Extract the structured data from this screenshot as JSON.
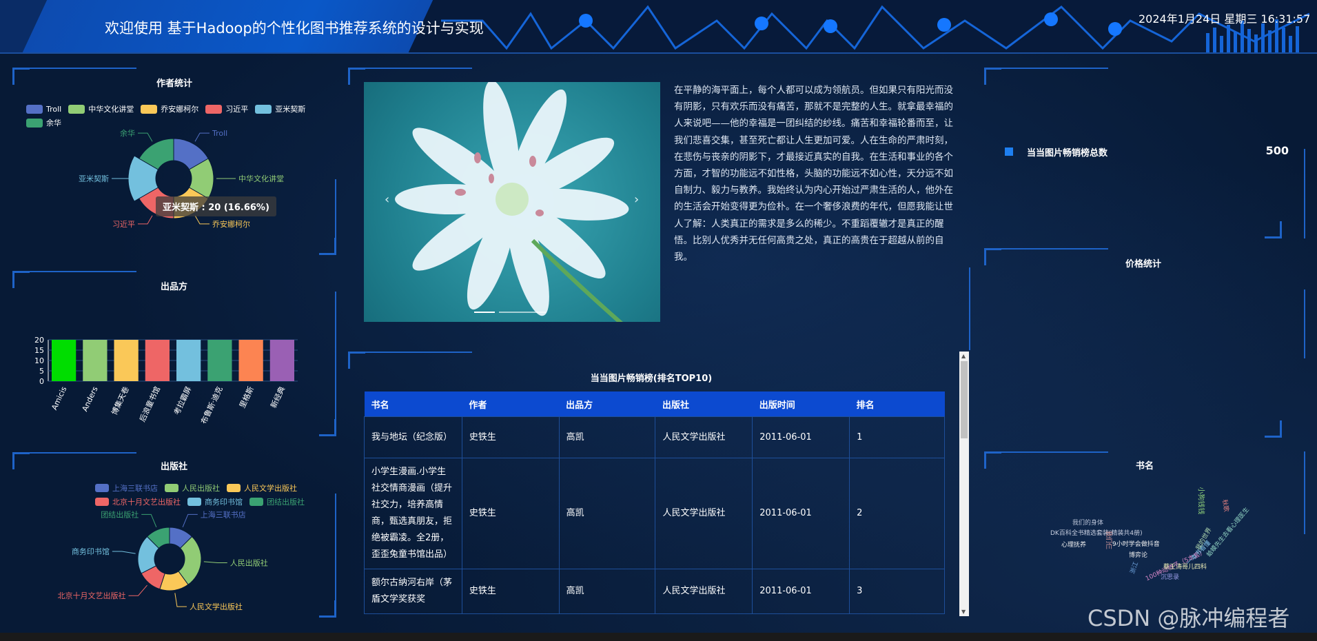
{
  "header": {
    "title": "欢迎使用 基于Hadoop的个性化图书推荐系统的设计与实现",
    "datetime": "2024年1月24日 星期三 16:31:57"
  },
  "author_panel": {
    "title": "作者统计",
    "legend": [
      "Troll",
      "中华文化讲堂",
      "乔安娜柯尔",
      "习近平",
      "亚米契斯",
      "余华"
    ],
    "labels": [
      "Troll",
      "中华文化讲堂",
      "乔安娜柯尔",
      "习近平",
      "亚米契斯",
      "余华"
    ],
    "tooltip": "亚米契斯 : 20 (16.66%)"
  },
  "producer_panel": {
    "title": "出品方"
  },
  "publisher_panel": {
    "title": "出版社",
    "legend": [
      "上海三联书店",
      "人民出版社",
      "人民文学出版社",
      "北京十月文艺出版社",
      "商务印书馆",
      "团结出版社"
    ],
    "labels": [
      "上海三联书店",
      "人民出版社",
      "人民文学出版社",
      "北京十月文艺出版社",
      "商务印书馆",
      "团结出版社"
    ]
  },
  "intro_text": "在平静的海平面上，每个人都可以成为领航员。但如果只有阳光而没有阴影，只有欢乐而没有痛苦，那就不是完整的人生。就拿最幸福的人来说吧——他的幸福是一团纠结的纱线。痛苦和幸福轮番而至，让我们悲喜交集，甚至死亡都让人生更加可爱。人在生命的严肃时刻，在悲伤与丧亲的阴影下，才最接近真实的自我。在生活和事业的各个方面，才智的功能远不如性格，头脑的功能远不如心性，天分远不如自制力、毅力与教养。我始终认为内心开始过严肃生活的人，他外在的生活会开始变得更为俭朴。在一个奢侈浪费的年代，但愿我能让世人了解：人类真正的需求是多么的稀少。不重蹈覆辙才是真正的醒悟。比别人优秀并无任何高贵之处，真正的高贵在于超越从前的自我。",
  "carousel": {
    "prev": "‹",
    "next": "›"
  },
  "table": {
    "title": "当当图片畅销榜(排名TOP10)",
    "headers": [
      "书名",
      "作者",
      "出品方",
      "出版社",
      "出版时间",
      "排名"
    ],
    "rows": [
      [
        "我与地坛（纪念版）",
        "史铁生",
        "高凯",
        "人民文学出版社",
        "2011-06-01",
        "1"
      ],
      [
        "小学生漫画.小学生社交情商漫画（提升社交力，培养高情商，甄选真朋友，拒绝被霸凌。全2册，歪歪兔童书馆出品）",
        "史铁生",
        "高凯",
        "人民文学出版社",
        "2011-06-01",
        "2"
      ],
      [
        "额尔古纳河右岸（茅盾文学奖获奖",
        "史铁生",
        "高凯",
        "人民文学出版社",
        "2011-06-01",
        "3"
      ]
    ]
  },
  "stat": {
    "label": "当当图片畅销榜总数",
    "value": "500"
  },
  "price_panel": {
    "title": "价格统计"
  },
  "wordcloud_panel": {
    "title": "书名",
    "words": [
      "我们的身体",
      "DK百科全书精选套装(精装共4册)",
      "心理抚养",
      "9小时学会做抖音",
      "博弈论",
      "100种动物子（5本套）",
      "一本书看懂",
      "蔡王涛哥儿四科",
      "沉思录",
      "浙江",
      "我们仨",
      "我的世界",
      "秋歌",
      "小狗钱钱",
      "蛤蟆先生去看心理医生"
    ]
  },
  "chart_data": [
    {
      "type": "pie",
      "title": "作者统计",
      "categories": [
        "Troll",
        "中华文化讲堂",
        "乔安娜柯尔",
        "习近平",
        "亚米契斯",
        "余华"
      ],
      "values": [
        20,
        20,
        20,
        20,
        20,
        20
      ],
      "colors": [
        "#5470c6",
        "#91cc75",
        "#fac858",
        "#ee6666",
        "#73c0de",
        "#3ba272"
      ]
    },
    {
      "type": "bar",
      "title": "出品方",
      "categories": [
        "Amicis",
        "Anders",
        "博集天卷",
        "后浪童书馆",
        "考拉霸屏",
        "布鲁斯·迪克",
        "里格斯",
        "新经典"
      ],
      "values": [
        20,
        20,
        20,
        20,
        20,
        20,
        20,
        20
      ],
      "ylim": [
        0,
        20
      ],
      "yticks": [
        0,
        5,
        10,
        15,
        20
      ],
      "colors": [
        "#00dd00",
        "#91cc75",
        "#fac858",
        "#ee6666",
        "#73c0de",
        "#3ba272",
        "#fc8452",
        "#9a60b4"
      ]
    },
    {
      "type": "pie",
      "title": "出版社",
      "categories": [
        "上海三联书店",
        "人民出版社",
        "人民文学出版社",
        "北京十月文艺出版社",
        "商务印书馆",
        "团结出版社"
      ],
      "values": [
        1,
        2.2,
        1.2,
        1,
        1.6,
        1
      ],
      "colors": [
        "#5470c6",
        "#91cc75",
        "#fac858",
        "#ee6666",
        "#73c0de",
        "#3ba272"
      ]
    }
  ]
}
